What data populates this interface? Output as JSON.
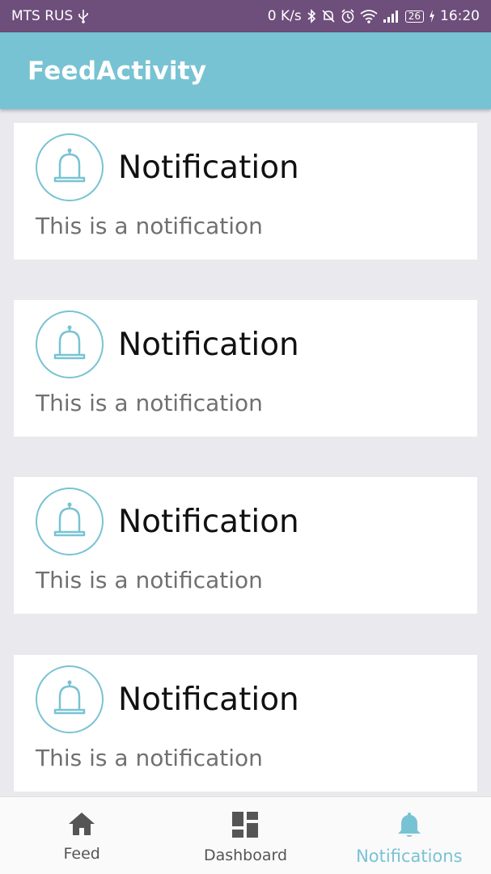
{
  "status_bar": {
    "carrier": "MTS RUS",
    "speed": "0 K/s",
    "battery": "26",
    "time": "16:20"
  },
  "app_bar": {
    "title": "FeedActivity"
  },
  "colors": {
    "accent": "#78c3d3",
    "status_bar": "#6e4e7b",
    "background": "#e9e9ee"
  },
  "notifications": [
    {
      "title": "Notification",
      "body": "This is a notification",
      "icon": "bell-icon"
    },
    {
      "title": "Notification",
      "body": "This is a notification",
      "icon": "bell-icon"
    },
    {
      "title": "Notification",
      "body": "This is a notification",
      "icon": "bell-icon"
    },
    {
      "title": "Notification",
      "body": "This is a notification",
      "icon": "bell-icon"
    }
  ],
  "bottom_nav": {
    "items": [
      {
        "label": "Feed",
        "icon": "home-icon",
        "active": false
      },
      {
        "label": "Dashboard",
        "icon": "dashboard-icon",
        "active": false
      },
      {
        "label": "Notifications",
        "icon": "bell-icon",
        "active": true
      }
    ]
  }
}
